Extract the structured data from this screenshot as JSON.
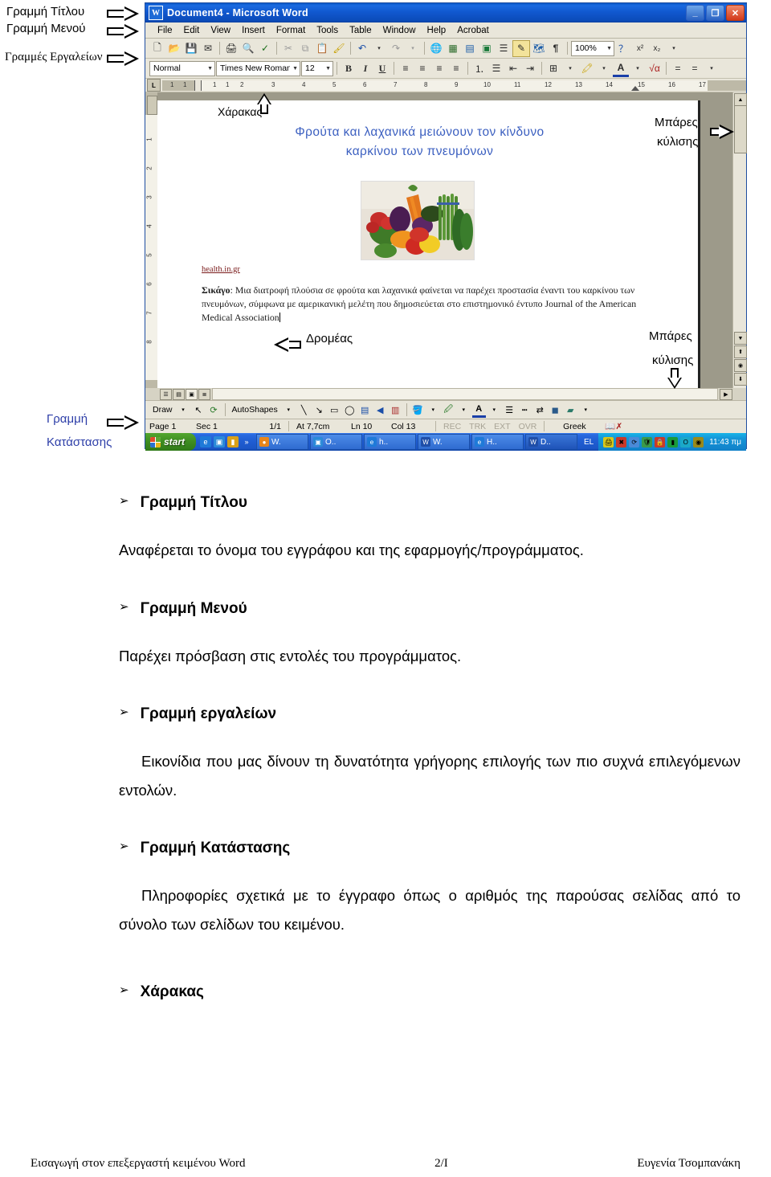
{
  "annotations": {
    "title_bar": "Γραμμή Τίτλου",
    "menu_bar": "Γραμμή Μενού",
    "toolbars": "Γραμμές Εργαλείων",
    "status_bar_line1": "Γραμμή",
    "status_bar_line2": "Κατάστασης",
    "ruler": "Χάρακας",
    "scrollbars_top_line1": "Μπάρες",
    "scrollbars_top_line2": "κύλισης",
    "scrollbars_bottom_line1": "Μπάρες",
    "scrollbars_bottom_line2": "κύλισης",
    "cursor": "Δρομέας"
  },
  "word_window": {
    "title": "Document4 - Microsoft Word",
    "app_icon": "word-document-icon",
    "window_buttons": {
      "minimize": "minimize-icon",
      "maximize": "restore-icon",
      "close": "close-icon"
    },
    "menu": [
      {
        "label": "File",
        "accel": "F"
      },
      {
        "label": "Edit",
        "accel": "E"
      },
      {
        "label": "View",
        "accel": "V"
      },
      {
        "label": "Insert",
        "accel": "I"
      },
      {
        "label": "Format",
        "accel": "o"
      },
      {
        "label": "Tools",
        "accel": "T"
      },
      {
        "label": "Table",
        "accel": "a"
      },
      {
        "label": "Window",
        "accel": "W"
      },
      {
        "label": "Help",
        "accel": "H"
      },
      {
        "label": "Acrobat",
        "accel": "b"
      }
    ],
    "standard_toolbar": {
      "icons": [
        "new-document-icon",
        "open-folder-icon",
        "save-icon",
        "email-icon",
        "print-icon",
        "print-preview-icon",
        "spelling-check-icon",
        "cut-scissors-icon",
        "copy-icon",
        "paste-icon",
        "format-painter-icon",
        "undo-icon",
        "undo-dropdown-icon",
        "redo-icon",
        "redo-dropdown-icon",
        "insert-hyperlink-icon",
        "tables-and-borders-icon",
        "insert-table-icon",
        "insert-excel-worksheet-icon",
        "columns-icon",
        "drawing-icon",
        "document-map-icon",
        "show-formatting-marks-icon"
      ],
      "zoom_value": "100%",
      "zoom_dropdown": "chevron-down-icon",
      "help_icon": "help-question-icon",
      "superscript_icon": "superscript-icon",
      "subscript_icon": "subscript-icon",
      "more_buttons_icon": "toolbar-overflow-icon"
    },
    "formatting_toolbar": {
      "style_value": "Normal",
      "font_value": "Times New Roman",
      "size_value": "12",
      "bold_label": "B",
      "italic_label": "I",
      "underline_label": "U",
      "icons": [
        "align-left-icon",
        "align-center-icon",
        "align-right-icon",
        "justify-icon",
        "numbered-list-icon",
        "bulleted-list-icon",
        "decrease-indent-icon",
        "increase-indent-icon",
        "borders-icon",
        "highlight-color-icon",
        "font-color-icon",
        "math-symbol-icon",
        "line-style-icon",
        "line-weight-icon",
        "toolbar-overflow-icon"
      ]
    },
    "ruler": {
      "corner_tab": "L",
      "numbers": [
        "1",
        "1",
        "1",
        "1",
        "1",
        "1",
        "2",
        "3",
        "4",
        "5",
        "6",
        "7",
        "8",
        "9",
        "10",
        "11",
        "12",
        "13",
        "14",
        "15",
        "16",
        "17"
      ],
      "vertical_numbers": [
        "1",
        "2",
        "3",
        "4",
        "5",
        "6",
        "7",
        "8"
      ]
    },
    "document": {
      "title_line1": "Φρούτα και λαχανικά μειώνουν τον κίνδυνο",
      "title_line2": "καρκίνου των πνευμόνων",
      "image_alt": "vegetables-photo",
      "source": "health.in.gr",
      "body_lead": "Σικάγο",
      "body_text": ": Μια διατροφή πλούσια σε φρούτα και λαχανικά φαίνεται να παρέχει προστασία έναντι του καρκίνου των πνευμόνων, σύμφωνα με αμερικανική μελέτη που δημοσιεύεται στο επιστημονικό έντυπο Journal of the American Medical Association"
    },
    "drawing_toolbar": {
      "draw_label": "Draw",
      "autoshapes_label": "AutoShapes",
      "icons": [
        "select-objects-arrow-icon",
        "free-rotate-icon",
        "line-icon",
        "arrow-icon",
        "rectangle-icon",
        "oval-icon",
        "text-box-icon",
        "insert-wordart-icon",
        "insert-clip-art-icon",
        "fill-color-icon",
        "line-color-icon",
        "font-color-icon",
        "line-style-icon",
        "dash-style-icon",
        "arrow-style-icon",
        "shadow-icon",
        "3d-icon"
      ]
    },
    "status_bar": {
      "page": "Page 1",
      "section": "Sec 1",
      "pages": "1/1",
      "at": "At 7,7cm",
      "line": "Ln 10",
      "column": "Col 13",
      "rec": "REC",
      "trk": "TRK",
      "ext": "EXT",
      "ovr": "OVR",
      "language": "Greek",
      "spell_icon": "spelling-status-icon"
    },
    "scroll": {
      "up_icon": "scroll-up-arrow-icon",
      "down_icon": "scroll-down-arrow-icon",
      "prev_page_icon": "previous-page-icon",
      "select_browse_icon": "select-browse-object-icon",
      "next_page_icon": "next-page-icon",
      "right_icon": "scroll-right-arrow-icon"
    },
    "view_buttons": [
      "normal-view-icon",
      "web-layout-view-icon",
      "print-layout-view-icon",
      "outline-view-icon"
    ]
  },
  "taskbar": {
    "start_label": "start",
    "quick_launch": [
      "internet-explorer-icon",
      "show-desktop-icon",
      "media-player-icon"
    ],
    "overflow_icon": "chevron-double-right-icon",
    "tasks": [
      {
        "label": "W.",
        "icon": "media-player-icon"
      },
      {
        "label": "O..",
        "icon": "explorer-icon"
      },
      {
        "label": "h..",
        "icon": "internet-explorer-icon"
      },
      {
        "label": "W.",
        "icon": "word-icon"
      },
      {
        "label": "H..",
        "icon": "internet-explorer-icon"
      },
      {
        "label": "D..",
        "icon": "word-icon"
      }
    ],
    "language_indicator": "EL",
    "tray_icons": [
      "printer-icon",
      "network-error-icon",
      "sync-icon",
      "antivirus-icon",
      "security-icon",
      "volume-bars-icon",
      "opera-icon",
      "shield-icon"
    ],
    "clock": "11:43 πμ"
  },
  "lesson": {
    "items": [
      {
        "bullet": "➢",
        "heading": "Γραμμή Τίτλου",
        "paragraph": "Αναφέρεται το όνομα του εγγράφου και της εφαρμογής/προγράμματος."
      },
      {
        "bullet": "➢",
        "heading": "Γραμμή Μενού",
        "paragraph": "Παρέχει πρόσβαση στις εντολές του προγράμματος."
      },
      {
        "bullet": "➢",
        "heading": "Γραμμή εργαλείων",
        "paragraph": "Εικονίδια που μας δίνουν τη δυνατότητα γρήγορης επιλογής των πιο συχνά επιλεγόμενων εντολών."
      },
      {
        "bullet": "➢",
        "heading": "Γραμμή Κατάστασης",
        "paragraph": "Πληροφορίες σχετικά με το έγγραφο όπως ο αριθμός της παρούσας σελίδας από το σύνολο των σελίδων του κειμένου."
      },
      {
        "bullet": "➢",
        "heading": "Χάρακας",
        "paragraph": ""
      }
    ]
  },
  "footer": {
    "left": "Εισαγωγή στον επεξεργαστή κειμένου Word",
    "center": "2/I",
    "right": "Ευγενία Τσομπανάκη"
  },
  "colors": {
    "title_blue": "#3b5fc0",
    "taskbar_blue": "#1b55c6",
    "start_green": "#3f8e22"
  }
}
